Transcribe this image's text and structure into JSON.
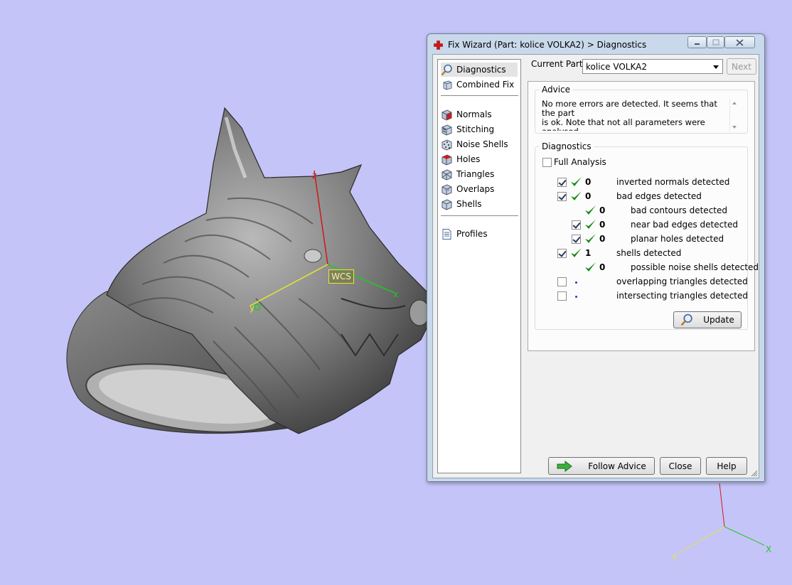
{
  "window": {
    "title": "Fix Wizard (Part: kolice VOLKA2) > Diagnostics",
    "controls": [
      "minimize",
      "maximize",
      "close"
    ]
  },
  "nav": {
    "items": [
      {
        "label": "Diagnostics",
        "icon": "magnifier-icon",
        "selected": true
      },
      {
        "label": "Combined Fix",
        "icon": "combined-fix-icon"
      },
      {
        "label": "Normals",
        "icon": "normals-icon"
      },
      {
        "label": "Stitching",
        "icon": "stitching-icon"
      },
      {
        "label": "Noise Shells",
        "icon": "noise-shells-icon"
      },
      {
        "label": "Holes",
        "icon": "holes-icon"
      },
      {
        "label": "Triangles",
        "icon": "triangles-icon"
      },
      {
        "label": "Overlaps",
        "icon": "overlaps-icon"
      },
      {
        "label": "Shells",
        "icon": "shells-icon"
      },
      {
        "label": "Profiles",
        "icon": "profiles-icon"
      }
    ]
  },
  "part": {
    "label": "Current Part:",
    "value": "kolice VOLKA2",
    "next_label": "Next"
  },
  "advice": {
    "title": "Advice",
    "text": "No more errors are detected. It seems that the part\nis ok. Note that not all parameters were analysed."
  },
  "diagnostics": {
    "title": "Diagnostics",
    "full_analysis_label": "Full Analysis",
    "full_analysis_checked": false,
    "rows": [
      {
        "checkbox": true,
        "checked": true,
        "status": "ok",
        "count": "0",
        "label": "inverted normals detected"
      },
      {
        "checkbox": true,
        "checked": true,
        "status": "ok",
        "count": "0",
        "label": "bad edges detected"
      },
      {
        "checkbox": false,
        "checked": false,
        "status": "ok",
        "count": "0",
        "label": "bad contours detected"
      },
      {
        "checkbox": true,
        "checked": true,
        "status": "ok",
        "count": "0",
        "label": "near bad edges detected"
      },
      {
        "checkbox": true,
        "checked": true,
        "status": "ok",
        "count": "0",
        "label": "planar holes detected"
      },
      {
        "checkbox": true,
        "checked": true,
        "status": "ok",
        "count": "1",
        "label": "shells detected"
      },
      {
        "checkbox": false,
        "checked": false,
        "status": "ok",
        "count": "0",
        "label": "possible noise shells detected"
      },
      {
        "checkbox": true,
        "checked": false,
        "status": "pending",
        "count": "",
        "label": "overlapping triangles detected"
      },
      {
        "checkbox": true,
        "checked": false,
        "status": "pending",
        "count": "",
        "label": "intersecting triangles detected"
      }
    ],
    "update_label": "Update"
  },
  "footer": {
    "follow_advice_label": "Follow Advice",
    "close_label": "Close",
    "help_label": "Help"
  },
  "viewport": {
    "wcs_label": "WCS",
    "axes": {
      "x": "x",
      "y": "y",
      "z": "z"
    },
    "corner_axes": {
      "x": "X",
      "y": "Y"
    },
    "colors": {
      "background": "#c4c4f8",
      "x_axis": "#22c822",
      "y_axis": "#e6e632",
      "z_axis": "#d01818"
    }
  }
}
